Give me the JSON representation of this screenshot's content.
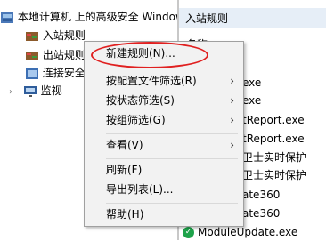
{
  "tree": {
    "root": "本地计算机 上的高级安全 Windows",
    "items": [
      {
        "label": "入站规则"
      },
      {
        "label": "出站规则"
      },
      {
        "label": "连接安全规则"
      },
      {
        "label": "监视"
      }
    ]
  },
  "right_pane": {
    "header": "入站规则",
    "partial_rows": [
      "名称",
      "exe",
      "exe",
      "tReport.exe",
      "tReport.exe",
      "卫士实时保护",
      "卫士实时保护",
      "ate360",
      "ate360"
    ],
    "last_row": "ModuleUpdate.exe"
  },
  "context_menu": {
    "items": [
      {
        "label": "新建规则(N)...",
        "submenu": false
      },
      {
        "label": "按配置文件筛选(R)",
        "submenu": true
      },
      {
        "label": "按状态筛选(S)",
        "submenu": true
      },
      {
        "label": "按组筛选(G)",
        "submenu": true
      },
      {
        "label": "查看(V)",
        "submenu": true
      },
      {
        "label": "刷新(F)",
        "submenu": false
      },
      {
        "label": "导出列表(L)...",
        "submenu": false
      },
      {
        "label": "帮助(H)",
        "submenu": false
      }
    ],
    "submenu_arrow": "›"
  },
  "colors": {
    "highlight_oval": "#e02020",
    "header_bg": "#e6eef7",
    "menu_bg": "#f2f2f2"
  }
}
